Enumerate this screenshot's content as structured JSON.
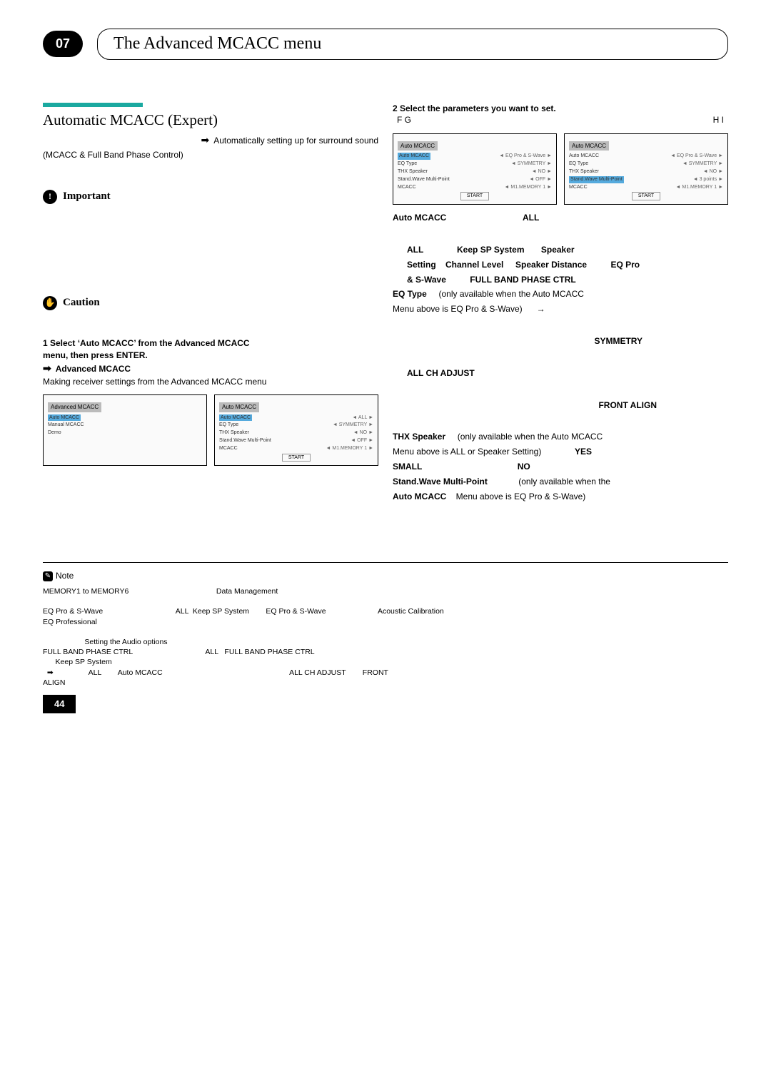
{
  "header": {
    "chapter": "07",
    "title": "The Advanced MCACC menu"
  },
  "left": {
    "section_title": "Automatic MCACC (Expert)",
    "arrow_line": "Automatically setting up for surround sound",
    "sub_line": "(MCACC & Full Band Phase Control)",
    "important_label": "Important",
    "caution_label": "Caution",
    "step1_a": "1   Select ‘Auto MCACC’ from the Advanced MCACC",
    "step1_b": "menu, then press ENTER.",
    "step1_arrow": "Advanced MCACC",
    "step1_desc": "Making receiver settings from the Advanced MCACC menu"
  },
  "right": {
    "step2": "2   Select the parameters you want to set.",
    "fg_left": "F  G",
    "fg_right": "H  I",
    "p_automcacc_a": "Auto MCACC",
    "p_automcacc_b": "ALL",
    "line_all": "ALL",
    "line_keepsp": "Keep SP System",
    "line_speaker": "Speaker",
    "line_setting": "Setting",
    "line_channel": "Channel Level",
    "line_spkdist": "Speaker Distance",
    "line_eqpro": "EQ Pro",
    "line_sw": "& S-Wave",
    "line_fullband": "FULL BAND PHASE CTRL",
    "eqtype_a": "EQ Type",
    "eqtype_b": "(only available when the Auto MCACC",
    "eqtype_c": "Menu above is EQ Pro & S-Wave)",
    "symmetry": "SYMMETRY",
    "allch": "ALL CH ADJUST",
    "frontalign": "FRONT ALIGN",
    "thx_a": "THX Speaker",
    "thx_b": "(only available when the Auto MCACC",
    "thx_c": "Menu above is ALL or Speaker Setting)",
    "thx_yes": "YES",
    "small": "SMALL",
    "no": "NO",
    "swmp_a": "Stand.Wave Multi-Point",
    "swmp_b": "(only available when the",
    "swmp_c": "Auto MCACC",
    "swmp_d": "Menu above is EQ Pro & S-Wave)"
  },
  "screens": {
    "a_title": "Advanced MCACC",
    "a_item1": "Auto MCACC",
    "a_item2": "Manual MCACC",
    "a_item3": "Demo",
    "b_title": "Auto MCACC",
    "b_l1_a": "Auto MCACC",
    "b_l1_b": "ALL",
    "b_l2_a": "EQ Type",
    "b_l2_b": "SYMMETRY",
    "b_l3_a": "THX Speaker",
    "b_l3_b": "NO",
    "b_l4_a": "Stand.Wave Multi-Point",
    "b_l4_b": "OFF",
    "b_l5_a": "MCACC",
    "b_l5_b": "M1.MEMORY 1",
    "b_start": "START",
    "c_title": "Auto MCACC",
    "c_l1_a": "Auto MCACC",
    "c_l1_b": "EQ Pro & S-Wave",
    "c_l2_a": "EQ Type",
    "c_l2_b": "SYMMETRY",
    "c_l3_a": "THX Speaker",
    "c_l3_b": "NO",
    "c_l4_a": "Stand.Wave Multi-Point",
    "c_l4_b": "OFF",
    "c_l5_a": "MCACC",
    "c_l5_b": "M1.MEMORY 1",
    "c_start": "START",
    "d_title": "Auto MCACC",
    "d_l1_a": "Auto MCACC",
    "d_l1_b": "EQ Pro & S-Wave",
    "d_l2_a": "EQ Type",
    "d_l2_b": "SYMMETRY",
    "d_l3_a": "THX Speaker",
    "d_l3_b": "NO",
    "d_l4_a": "Stand.Wave Multi-Point",
    "d_l4_b": "3 points",
    "d_l5_a": "MCACC",
    "d_l5_b": "M1.MEMORY 1",
    "d_start": "START"
  },
  "notes": {
    "label": "Note",
    "left": "MEMORY1 to MEMORY6                                          Data Management\n\nEQ Pro & S-Wave                                   ALL  Keep SP System        EQ Pro & S-Wave                         Acoustic Calibration\nEQ Professional\n\n                    Setting the Audio options\nFULL BAND PHASE CTRL                                   ALL   FULL BAND PHASE CTRL\n      Keep SP System\n  ➡                 ALL        Auto MCACC                                                             ALL CH ADJUST        FRONT\nALIGN",
    "right": "Auto MCACC"
  },
  "page": "44"
}
